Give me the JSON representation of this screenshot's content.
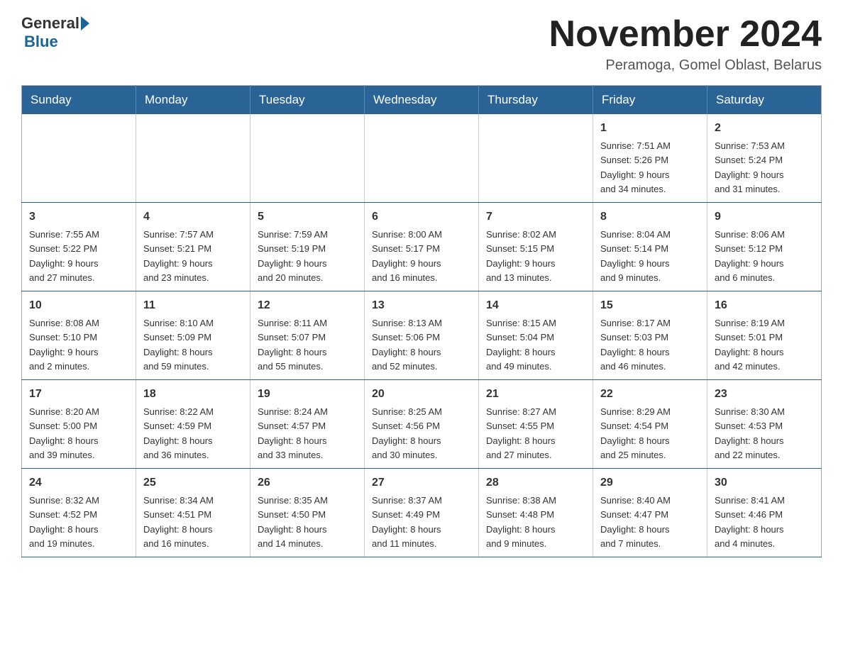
{
  "header": {
    "logo_general": "General",
    "logo_blue": "Blue",
    "month_title": "November 2024",
    "location": "Peramoga, Gomel Oblast, Belarus"
  },
  "days_of_week": [
    "Sunday",
    "Monday",
    "Tuesday",
    "Wednesday",
    "Thursday",
    "Friday",
    "Saturday"
  ],
  "weeks": [
    [
      {
        "day": "",
        "info": ""
      },
      {
        "day": "",
        "info": ""
      },
      {
        "day": "",
        "info": ""
      },
      {
        "day": "",
        "info": ""
      },
      {
        "day": "",
        "info": ""
      },
      {
        "day": "1",
        "info": "Sunrise: 7:51 AM\nSunset: 5:26 PM\nDaylight: 9 hours\nand 34 minutes."
      },
      {
        "day": "2",
        "info": "Sunrise: 7:53 AM\nSunset: 5:24 PM\nDaylight: 9 hours\nand 31 minutes."
      }
    ],
    [
      {
        "day": "3",
        "info": "Sunrise: 7:55 AM\nSunset: 5:22 PM\nDaylight: 9 hours\nand 27 minutes."
      },
      {
        "day": "4",
        "info": "Sunrise: 7:57 AM\nSunset: 5:21 PM\nDaylight: 9 hours\nand 23 minutes."
      },
      {
        "day": "5",
        "info": "Sunrise: 7:59 AM\nSunset: 5:19 PM\nDaylight: 9 hours\nand 20 minutes."
      },
      {
        "day": "6",
        "info": "Sunrise: 8:00 AM\nSunset: 5:17 PM\nDaylight: 9 hours\nand 16 minutes."
      },
      {
        "day": "7",
        "info": "Sunrise: 8:02 AM\nSunset: 5:15 PM\nDaylight: 9 hours\nand 13 minutes."
      },
      {
        "day": "8",
        "info": "Sunrise: 8:04 AM\nSunset: 5:14 PM\nDaylight: 9 hours\nand 9 minutes."
      },
      {
        "day": "9",
        "info": "Sunrise: 8:06 AM\nSunset: 5:12 PM\nDaylight: 9 hours\nand 6 minutes."
      }
    ],
    [
      {
        "day": "10",
        "info": "Sunrise: 8:08 AM\nSunset: 5:10 PM\nDaylight: 9 hours\nand 2 minutes."
      },
      {
        "day": "11",
        "info": "Sunrise: 8:10 AM\nSunset: 5:09 PM\nDaylight: 8 hours\nand 59 minutes."
      },
      {
        "day": "12",
        "info": "Sunrise: 8:11 AM\nSunset: 5:07 PM\nDaylight: 8 hours\nand 55 minutes."
      },
      {
        "day": "13",
        "info": "Sunrise: 8:13 AM\nSunset: 5:06 PM\nDaylight: 8 hours\nand 52 minutes."
      },
      {
        "day": "14",
        "info": "Sunrise: 8:15 AM\nSunset: 5:04 PM\nDaylight: 8 hours\nand 49 minutes."
      },
      {
        "day": "15",
        "info": "Sunrise: 8:17 AM\nSunset: 5:03 PM\nDaylight: 8 hours\nand 46 minutes."
      },
      {
        "day": "16",
        "info": "Sunrise: 8:19 AM\nSunset: 5:01 PM\nDaylight: 8 hours\nand 42 minutes."
      }
    ],
    [
      {
        "day": "17",
        "info": "Sunrise: 8:20 AM\nSunset: 5:00 PM\nDaylight: 8 hours\nand 39 minutes."
      },
      {
        "day": "18",
        "info": "Sunrise: 8:22 AM\nSunset: 4:59 PM\nDaylight: 8 hours\nand 36 minutes."
      },
      {
        "day": "19",
        "info": "Sunrise: 8:24 AM\nSunset: 4:57 PM\nDaylight: 8 hours\nand 33 minutes."
      },
      {
        "day": "20",
        "info": "Sunrise: 8:25 AM\nSunset: 4:56 PM\nDaylight: 8 hours\nand 30 minutes."
      },
      {
        "day": "21",
        "info": "Sunrise: 8:27 AM\nSunset: 4:55 PM\nDaylight: 8 hours\nand 27 minutes."
      },
      {
        "day": "22",
        "info": "Sunrise: 8:29 AM\nSunset: 4:54 PM\nDaylight: 8 hours\nand 25 minutes."
      },
      {
        "day": "23",
        "info": "Sunrise: 8:30 AM\nSunset: 4:53 PM\nDaylight: 8 hours\nand 22 minutes."
      }
    ],
    [
      {
        "day": "24",
        "info": "Sunrise: 8:32 AM\nSunset: 4:52 PM\nDaylight: 8 hours\nand 19 minutes."
      },
      {
        "day": "25",
        "info": "Sunrise: 8:34 AM\nSunset: 4:51 PM\nDaylight: 8 hours\nand 16 minutes."
      },
      {
        "day": "26",
        "info": "Sunrise: 8:35 AM\nSunset: 4:50 PM\nDaylight: 8 hours\nand 14 minutes."
      },
      {
        "day": "27",
        "info": "Sunrise: 8:37 AM\nSunset: 4:49 PM\nDaylight: 8 hours\nand 11 minutes."
      },
      {
        "day": "28",
        "info": "Sunrise: 8:38 AM\nSunset: 4:48 PM\nDaylight: 8 hours\nand 9 minutes."
      },
      {
        "day": "29",
        "info": "Sunrise: 8:40 AM\nSunset: 4:47 PM\nDaylight: 8 hours\nand 7 minutes."
      },
      {
        "day": "30",
        "info": "Sunrise: 8:41 AM\nSunset: 4:46 PM\nDaylight: 8 hours\nand 4 minutes."
      }
    ]
  ]
}
